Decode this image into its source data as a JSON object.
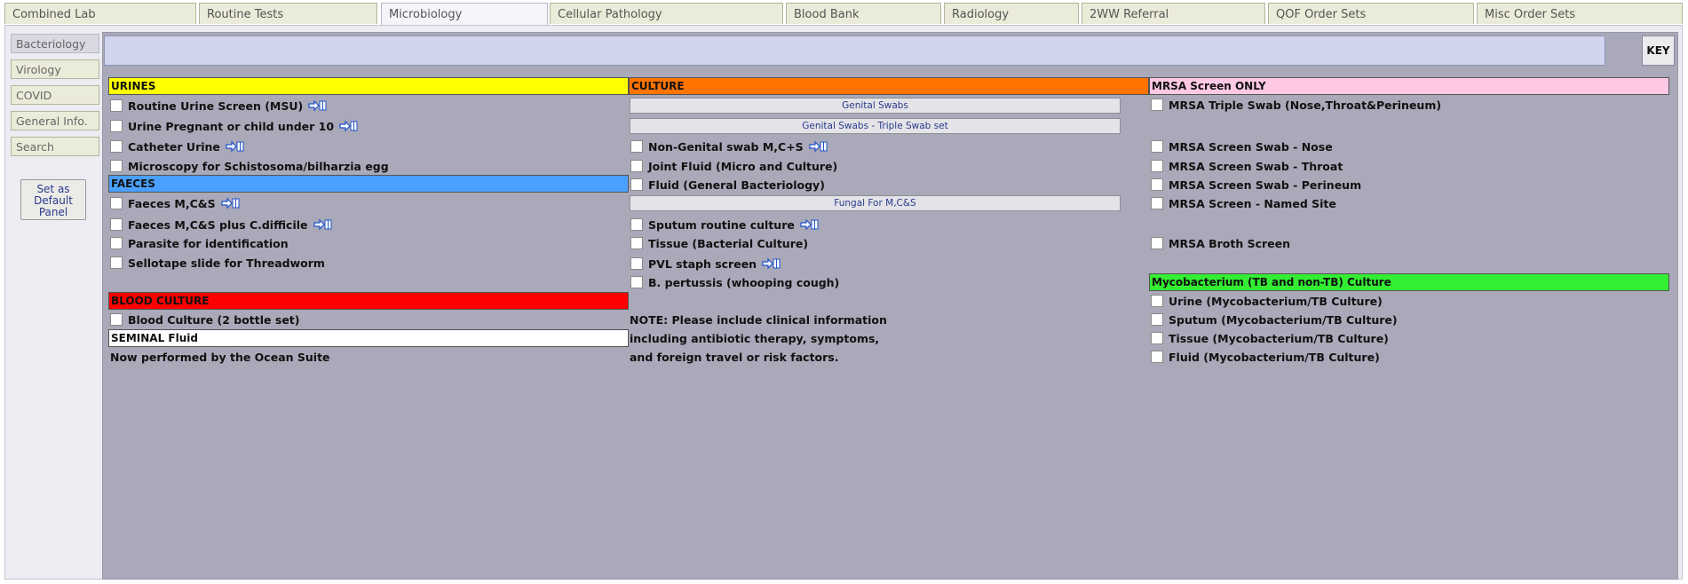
{
  "tabs": [
    "Combined Lab",
    "Routine Tests",
    "Microbiology",
    "Cellular Pathology",
    "Blood Bank",
    "Radiology",
    "2WW Referral",
    "QOF Order Sets",
    "Misc Order Sets"
  ],
  "active_tab": "Microbiology",
  "sidebar": {
    "items": [
      "Bacteriology",
      "Virology",
      "COVID",
      "General Info.",
      "Search"
    ],
    "active": "Bacteriology",
    "default_button": [
      "Set as",
      "Default",
      "Panel"
    ]
  },
  "key_button": "KEY",
  "colors": {
    "urines": "#ffff00",
    "culture": "#ff7300",
    "mrsa": "#ffc8e4",
    "faeces": "#4aa0ff",
    "blood": "#ff0000",
    "seminal": "#ffffff",
    "myco": "#33ee33"
  },
  "icons": {
    "info": "info-arrow-book-icon"
  },
  "urines": {
    "header": "URINES",
    "items": [
      {
        "label": "Routine Urine Screen (MSU)",
        "info": true
      },
      {
        "label": "Urine Pregnant or child under 10",
        "info": true
      },
      {
        "label": "Catheter Urine",
        "info": true
      },
      {
        "label": "Microscopy for Schistosoma/bilharzia egg",
        "info": false
      }
    ]
  },
  "faeces": {
    "header": "FAECES",
    "items": [
      {
        "label": "Faeces M,C&S",
        "info": true
      },
      {
        "label": "Faeces M,C&S plus C.difficile",
        "info": true
      },
      {
        "label": "Parasite for identification",
        "info": false
      },
      {
        "label": "Sellotape slide for Threadworm",
        "info": false
      }
    ]
  },
  "blood_culture": {
    "header": "BLOOD CULTURE",
    "items": [
      {
        "label": "Blood Culture (2 bottle set)",
        "info": false
      }
    ]
  },
  "seminal": {
    "header": "SEMINAL Fluid",
    "note": "Now performed by the Ocean Suite"
  },
  "culture": {
    "header": "CULTURE",
    "buttons": [
      "Genital Swabs",
      "Genital Swabs - Triple Swab set",
      "Fungal For M,C&S"
    ],
    "items": [
      {
        "label": "Non-Genital swab M,C+S",
        "info": true
      },
      {
        "label": "Joint Fluid (Micro and Culture)",
        "info": false
      },
      {
        "label": "Fluid (General Bacteriology)",
        "info": false
      },
      {
        "label": "Sputum routine culture",
        "info": true
      },
      {
        "label": "Tissue (Bacterial Culture)",
        "info": false
      },
      {
        "label": "PVL staph screen",
        "info": true
      },
      {
        "label": "B. pertussis (whooping cough)",
        "info": false
      }
    ],
    "note": [
      "NOTE: Please include clinical information",
      "including antibiotic therapy, symptoms,",
      "and foreign travel or risk factors."
    ]
  },
  "mrsa": {
    "header": "MRSA Screen ONLY",
    "items": [
      {
        "label": "MRSA Triple Swab (Nose,Throat&Perineum)"
      },
      {
        "label": "MRSA Screen Swab - Nose"
      },
      {
        "label": "MRSA Screen Swab - Throat"
      },
      {
        "label": "MRSA Screen Swab - Perineum"
      },
      {
        "label": "MRSA Screen - Named Site"
      },
      {
        "label": "MRSA Broth Screen"
      }
    ]
  },
  "myco": {
    "header": "Mycobacterium (TB and non-TB) Culture",
    "items": [
      {
        "label": "Urine (Mycobacterium/TB Culture)"
      },
      {
        "label": "Sputum (Mycobacterium/TB Culture)"
      },
      {
        "label": "Tissue (Mycobacterium/TB Culture)"
      },
      {
        "label": "Fluid (Mycobacterium/TB Culture)"
      }
    ]
  }
}
